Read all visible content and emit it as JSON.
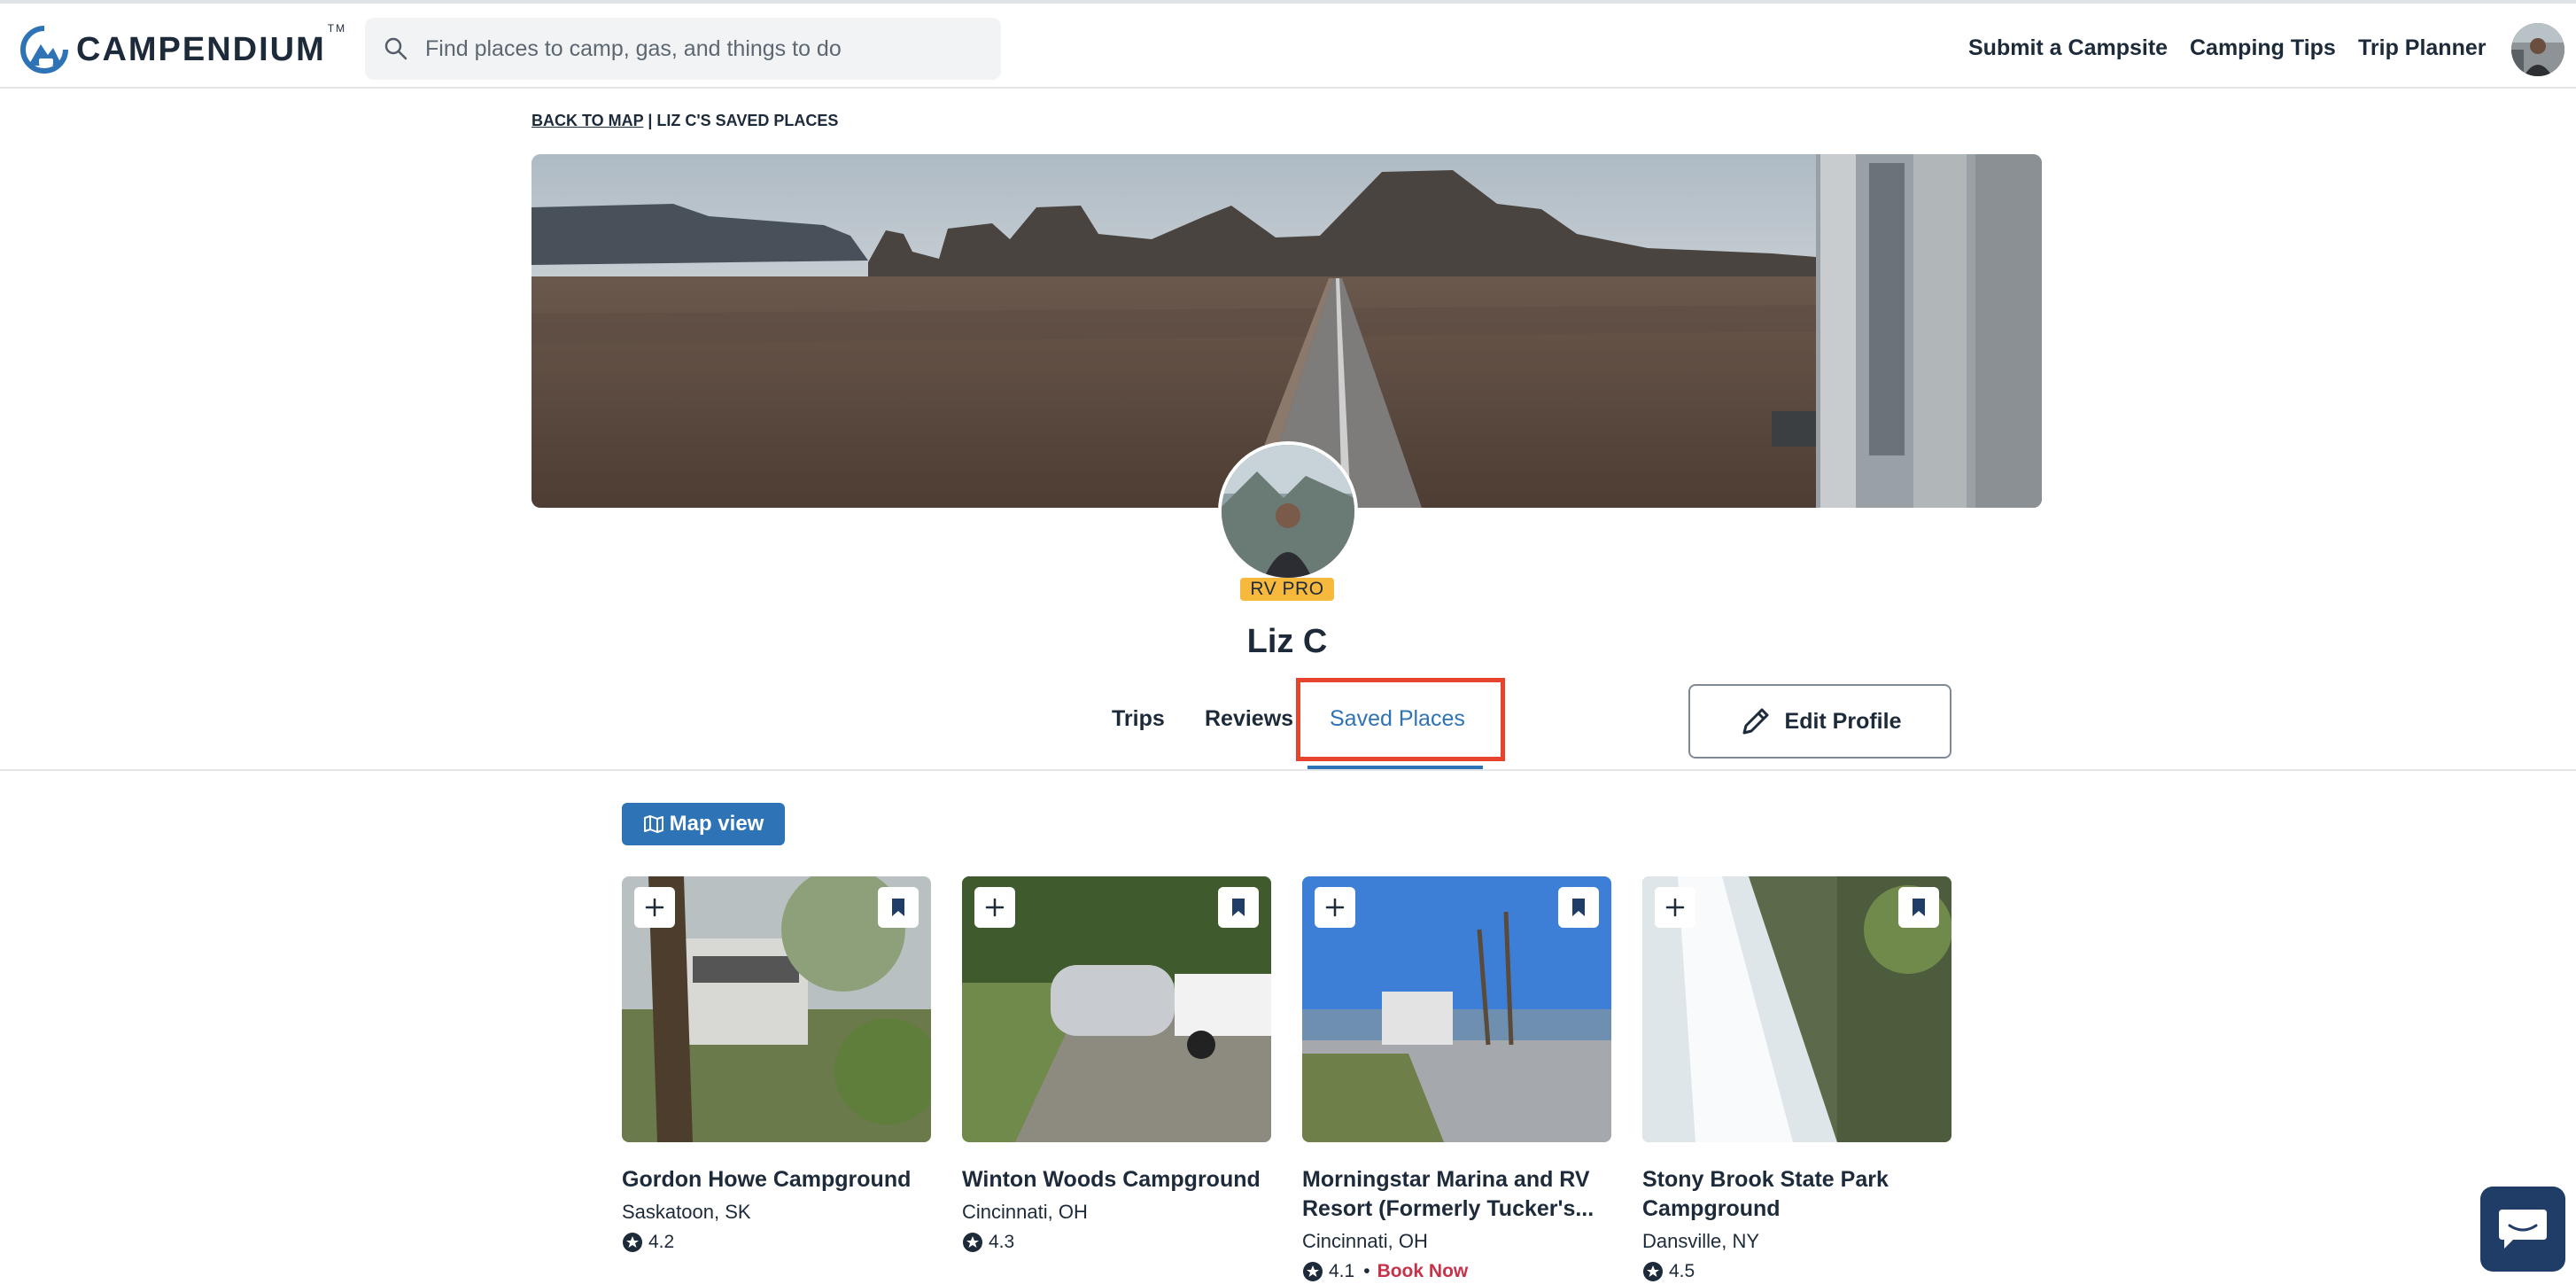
{
  "header": {
    "logo_text": "CAMPENDIUM",
    "logo_tm": "TM",
    "search_placeholder": "Find places to camp, gas, and things to do",
    "nav": [
      "Submit a Campsite",
      "Camping Tips",
      "Trip Planner"
    ]
  },
  "breadcrumb": {
    "back_label": "BACK TO MAP",
    "separator": " | ",
    "current": "LIZ C'S SAVED PLACES"
  },
  "profile": {
    "badge": "RV PRO",
    "name": "Liz C",
    "edit_label": "Edit Profile"
  },
  "tabs": [
    "Trips",
    "Reviews",
    "Saved Places"
  ],
  "active_tab": "Saved Places",
  "map_view_label": "Map view",
  "cards": [
    {
      "title": "Gordon Howe Campground",
      "location": "Saskatoon, SK",
      "rating": "4.2",
      "book": ""
    },
    {
      "title": "Winton Woods Campground",
      "location": "Cincinnati, OH",
      "rating": "4.3",
      "book": ""
    },
    {
      "title": "Morningstar Marina and RV Resort (Formerly Tucker's...",
      "location": "Cincinnati, OH",
      "rating": "4.1",
      "book": "Book Now"
    },
    {
      "title": "Stony Brook State Park Campground",
      "location": "Dansville, NY",
      "rating": "4.5",
      "book": ""
    }
  ],
  "colors": {
    "accent": "#2f73b7",
    "highlight": "#e8432c",
    "badge": "#f6b93b",
    "book_now": "#c8314a",
    "chat": "#1f3d66"
  },
  "icons": [
    "search-icon",
    "pencil-icon",
    "map-icon",
    "plus-icon",
    "bookmark-icon",
    "star-icon",
    "chat-icon"
  ]
}
